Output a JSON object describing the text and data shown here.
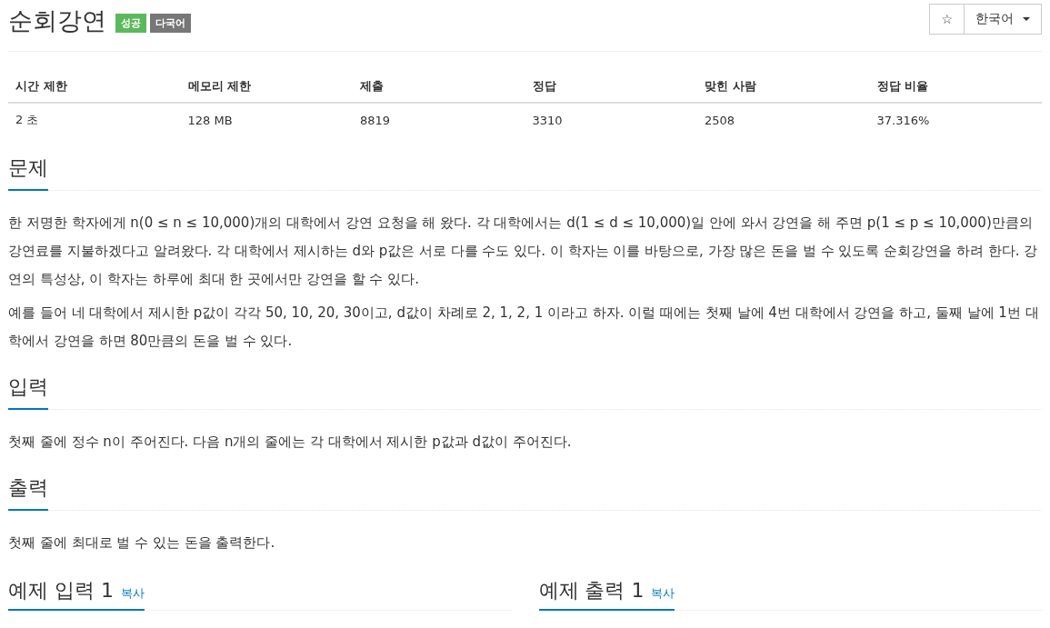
{
  "title": "순회강연",
  "badges": [
    {
      "label": "성공",
      "color": "#5cb85c"
    },
    {
      "label": "다국어",
      "color": "#777777"
    }
  ],
  "star_button": {
    "label": "☆"
  },
  "language_dropdown": {
    "value": "한국어"
  },
  "info_table": {
    "columns": [
      "시간 제한",
      "메모리 제한",
      "제출",
      "정답",
      "맞힌 사람",
      "정답 비율"
    ],
    "rows": [
      [
        "2 초",
        "128 MB",
        "8819",
        "3310",
        "2508",
        "37.316%"
      ]
    ]
  },
  "sections": [
    {
      "heading": "문제",
      "paragraphs": [
        "한 저명한 학자에게 n(0 ≤ n ≤ 10,000)개의 대학에서 강연 요청을 해 왔다. 각 대학에서는 d(1 ≤ d ≤ 10,000)일 안에 와서 강연을 해 주면 p(1 ≤ p ≤ 10,000)만큼의 강연료를 지불하겠다고 알려왔다. 각 대학에서 제시하는 d와 p값은 서로 다를 수도 있다. 이 학자는 이를 바탕으로, 가장 많은 돈을 벌 수 있도록 순회강연을 하려 한다. 강연의 특성상, 이 학자는 하루에 최대 한 곳에서만 강연을 할 수 있다.",
        "예를 들어 네 대학에서 제시한 p값이 각각 50, 10, 20, 30이고, d값이 차례로 2, 1, 2, 1 이라고 하자. 이럴 때에는 첫째 날에 4번 대학에서 강연을 하고, 둘째 날에 1번 대학에서 강연을 하면 80만큼의 돈을 벌 수 있다."
      ]
    },
    {
      "heading": "입력",
      "paragraphs": [
        "첫째 줄에 정수 n이 주어진다. 다음 n개의 줄에는 각 대학에서 제시한 p값과 d값이 주어진다."
      ]
    },
    {
      "heading": "출력",
      "paragraphs": [
        "첫째 줄에 최대로 벌 수 있는 돈을 출력한다."
      ]
    }
  ],
  "samples": [
    {
      "heading": "예제 입력 1",
      "copy_link": "복사"
    },
    {
      "heading": "예제 출력 1",
      "copy_link": "복사"
    }
  ]
}
